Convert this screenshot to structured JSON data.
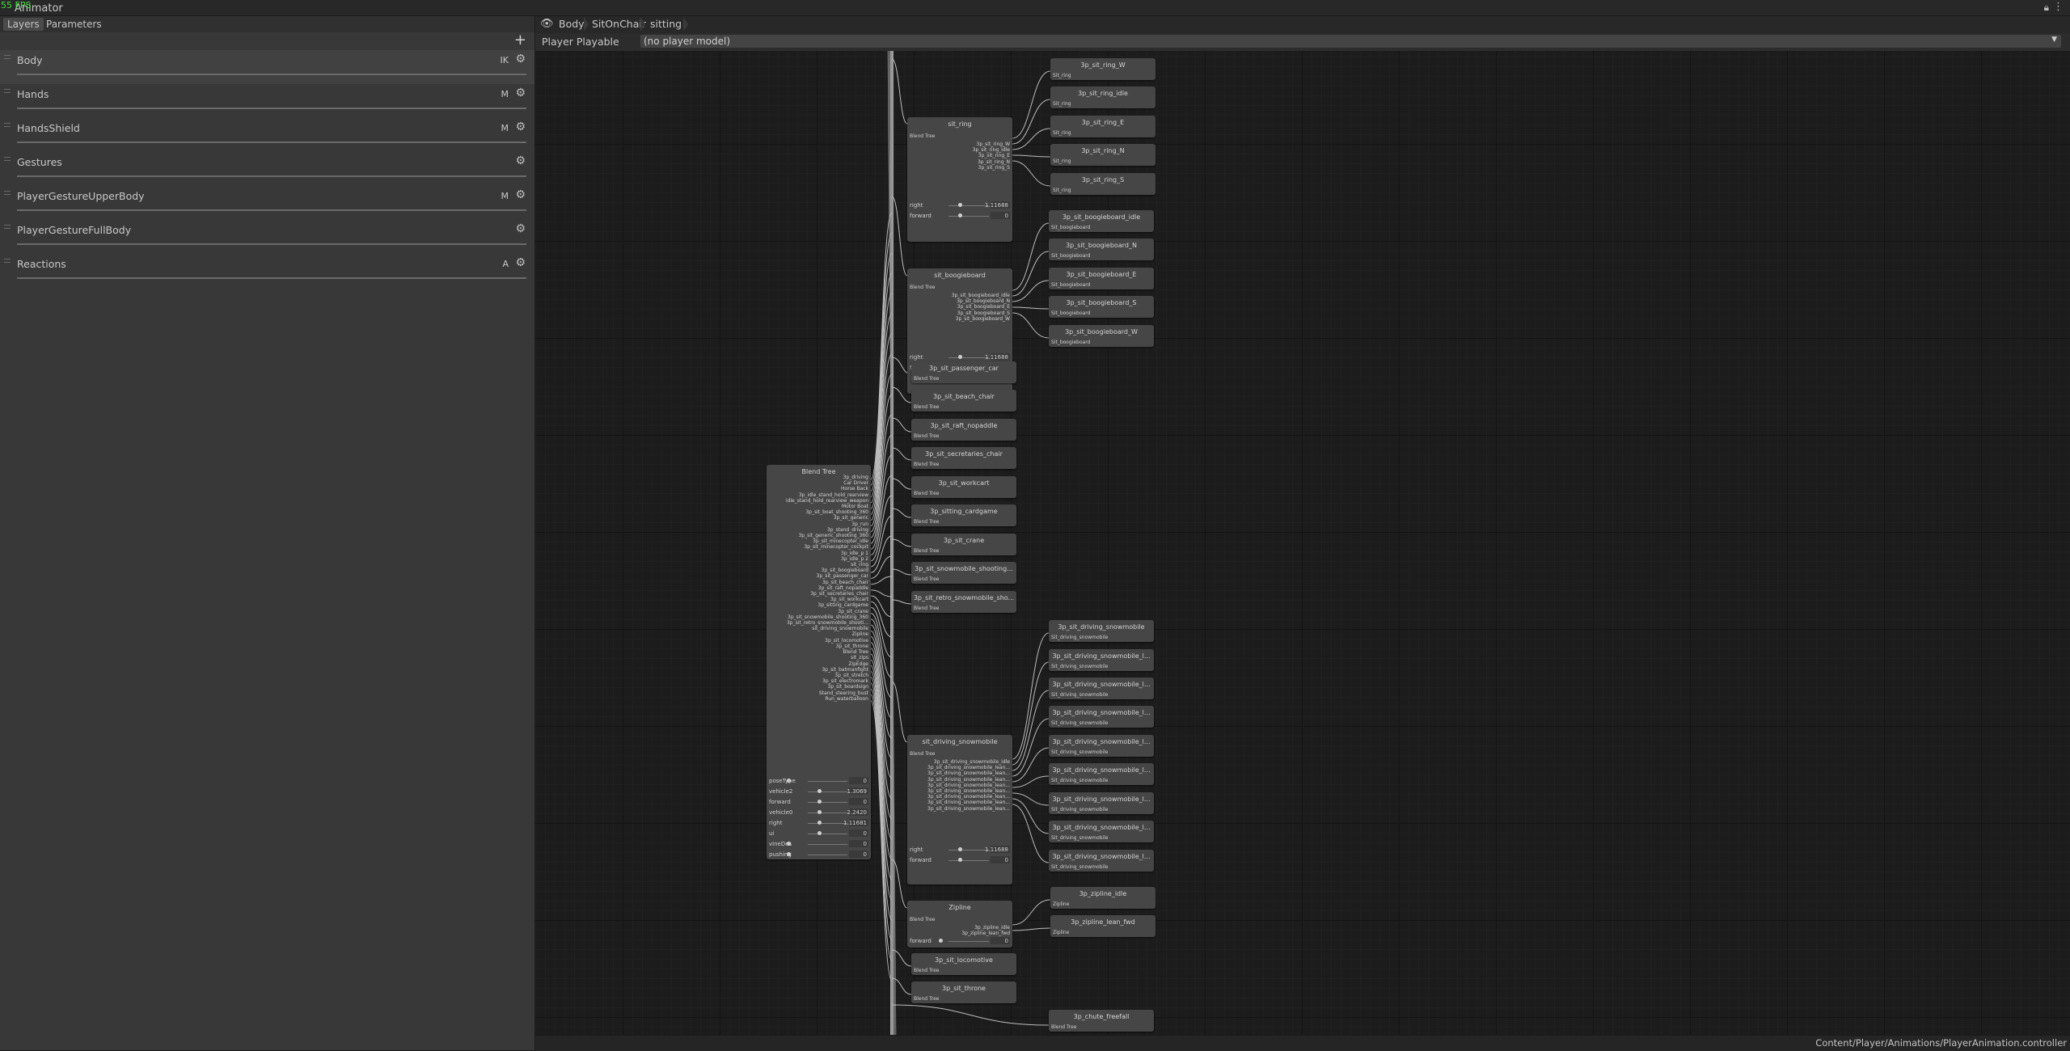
{
  "app": {
    "fps": "55 FPS",
    "title": "Animator"
  },
  "tabs": {
    "layers": "Layers",
    "parameters": "Parameters"
  },
  "add_layer": "+",
  "layers": [
    {
      "name": "Body",
      "badge": "IK"
    },
    {
      "name": "Hands",
      "badge": "M"
    },
    {
      "name": "HandsShield",
      "badge": "M"
    },
    {
      "name": "Gestures",
      "badge": ""
    },
    {
      "name": "PlayerGestureUpperBody",
      "badge": "M"
    },
    {
      "name": "PlayerGestureFullBody",
      "badge": ""
    },
    {
      "name": "Reactions",
      "badge": "A"
    }
  ],
  "breadcrumb": [
    "Body",
    "SitOnChair",
    "sitting"
  ],
  "player": {
    "label": "Player Playable",
    "value": "(no player model)"
  },
  "status_path": "Content/Player/Animations/PlayerAnimation.controller",
  "graph": {
    "main": {
      "title": "Blend Tree",
      "children": [
        "3p_driving",
        "Car Driver",
        "Horse Back",
        "3p_idle_stand_hold_rearview",
        "idle_stand_hold_rearview_weapon",
        "Motor Boat",
        "3p_sit_boat_shooting_360",
        "3p_sit_generic",
        "3p_run",
        "3p_stand_driving",
        "3p_sit_generic_shooting_360",
        "3p_sit_minecopter_idle",
        "3p_sit_minecopter_cockpit",
        "3p_idle_p 1",
        "3p_idle_p 2",
        "sit_ring",
        "3p_sit_boogieboard",
        "3p_sit_passenger_car",
        "3p_sit_beach_chair",
        "3p_sit_raft_nopaddle",
        "3p_sit_secretaries_chair",
        "3p_sit_workcart",
        "3p_sitting_cardgame",
        "3p_sit_crane",
        "3p_sit_snowmobile_shooting_360",
        "3p_sit_retro_snowmobile_shooti...",
        "sit_driving_snowmobile",
        "Zipline",
        "3p_sit_locomotive",
        "3p_sit_throne",
        "Blend Tree",
        "sit_zips",
        "ZipEdge",
        "3p_sit_batmanfight",
        "3p_sit_stretch",
        "3p_sit_electromark",
        "3p_sit_boardsign",
        "Stand_steering_bust",
        "Run_waterballoon"
      ],
      "params": [
        {
          "name": "poseType",
          "value": "0"
        },
        {
          "name": "vehicle2",
          "value": "1.3069"
        },
        {
          "name": "forward",
          "value": "0"
        },
        {
          "name": "vehicle0",
          "value": "2.2420"
        },
        {
          "name": "right",
          "value": "1.11681"
        },
        {
          "name": "ui",
          "value": "0"
        },
        {
          "name": "vineDes",
          "value": "0"
        },
        {
          "name": "pushing",
          "value": "0"
        }
      ]
    },
    "sit_ring": {
      "title": "sit_ring",
      "sub": "Blend Tree",
      "children": [
        "3p_sit_ring_W",
        "3p_sit_ring_idle",
        "3p_sit_ring_E",
        "3p_sit_ring_N",
        "3p_sit_ring_S"
      ],
      "params": [
        {
          "name": "right",
          "value": "1.11688"
        },
        {
          "name": "forward",
          "value": "0"
        }
      ]
    },
    "sit_boogieboard": {
      "title": "sit_boogieboard",
      "sub": "Blend Tree",
      "children": [
        "3p_sit_boogieboard_idle",
        "3p_sit_boogieboard_N",
        "3p_sit_boogieboard_E",
        "3p_sit_boogieboard_S",
        "3p_sit_boogieboard_W"
      ],
      "params": [
        {
          "name": "right",
          "value": "1.11688"
        },
        {
          "name": "forward",
          "value": "0"
        }
      ]
    },
    "sit_driving_snowmobile": {
      "title": "sit_driving_snowmobile",
      "sub": "Blend Tree",
      "children": [
        "3p_sit_driving_snowmobile_idle",
        "3p_sit_driving_snowmobile_lean...",
        "3p_sit_driving_snowmobile_lean...",
        "3p_sit_driving_snowmobile_lean...",
        "3p_sit_driving_snowmobile_lean...",
        "3p_sit_driving_snowmobile_lean...",
        "3p_sit_driving_snowmobile_lean...",
        "3p_sit_driving_snowmobile_lean...",
        "3p_sit_driving_snowmobile_lean..."
      ],
      "params": [
        {
          "name": "right",
          "value": "1.11688"
        },
        {
          "name": "forward",
          "value": "0"
        }
      ]
    },
    "zipline": {
      "title": "Zipline",
      "sub": "Blend Tree",
      "children": [
        "3p_zipline_idle",
        "3p_zipline_lean_fwd"
      ],
      "params": [
        {
          "name": "forward",
          "value": "0"
        }
      ]
    },
    "ring_clips": [
      {
        "title": "3p_sit_ring_W",
        "sub": "Sit_ring"
      },
      {
        "title": "3p_sit_ring_idle",
        "sub": "Sit_ring"
      },
      {
        "title": "3p_sit_ring_E",
        "sub": "Sit_ring"
      },
      {
        "title": "3p_sit_ring_N",
        "sub": "Sit_ring"
      },
      {
        "title": "3p_sit_ring_S",
        "sub": "Sit_ring"
      }
    ],
    "boogie_clips": [
      {
        "title": "3p_sit_boogieboard_idle",
        "sub": "Sit_boogieboard"
      },
      {
        "title": "3p_sit_boogieboard_N",
        "sub": "Sit_boogieboard"
      },
      {
        "title": "3p_sit_boogieboard_E",
        "sub": "Sit_boogieboard"
      },
      {
        "title": "3p_sit_boogieboard_S",
        "sub": "Sit_boogieboard"
      },
      {
        "title": "3p_sit_boogieboard_W",
        "sub": "Sit_boogieboard"
      }
    ],
    "subtrees": [
      {
        "title": "3p_sit_passenger_car",
        "sub": "Blend Tree"
      },
      {
        "title": "3p_sit_beach_chair",
        "sub": "Blend Tree"
      },
      {
        "title": "3p_sit_raft_nopaddle",
        "sub": "Blend Tree"
      },
      {
        "title": "3p_sit_secretaries_chair",
        "sub": "Blend Tree"
      },
      {
        "title": "3p_sit_workcart",
        "sub": "Blend Tree"
      },
      {
        "title": "3p_sitting_cardgame",
        "sub": "Blend Tree"
      },
      {
        "title": "3p_sit_crane",
        "sub": "Blend Tree"
      },
      {
        "title": "3p_sit_snowmobile_shooting...",
        "sub": "Blend Tree"
      },
      {
        "title": "3p_sit_retro_snowmobile_sho...",
        "sub": "Blend Tree"
      }
    ],
    "snow_clips": [
      {
        "title": "3p_sit_driving_snowmobile",
        "sub": "Sit_driving_snowmobile"
      },
      {
        "title": "3p_sit_driving_snowmobile_l...",
        "sub": "Sit_driving_snowmobile"
      },
      {
        "title": "3p_sit_driving_snowmobile_l...",
        "sub": "Sit_driving_snowmobile"
      },
      {
        "title": "3p_sit_driving_snowmobile_l...",
        "sub": "Sit_driving_snowmobile"
      },
      {
        "title": "3p_sit_driving_snowmobile_l...",
        "sub": "Sit_driving_snowmobile"
      },
      {
        "title": "3p_sit_driving_snowmobile_l...",
        "sub": "Sit_driving_snowmobile"
      },
      {
        "title": "3p_sit_driving_snowmobile_l...",
        "sub": "Sit_driving_snowmobile"
      },
      {
        "title": "3p_sit_driving_snowmobile_l...",
        "sub": "Sit_driving_snowmobile"
      },
      {
        "title": "3p_sit_driving_snowmobile_l...",
        "sub": "Sit_driving_snowmobile"
      }
    ],
    "zip_clips": [
      {
        "title": "3p_zipline_idle",
        "sub": "Zipline"
      },
      {
        "title": "3p_zipline_lean_fwd",
        "sub": "Zipline"
      }
    ],
    "bottom_subtrees": [
      {
        "title": "3p_sit_locomotive",
        "sub": "Blend Tree"
      },
      {
        "title": "3p_sit_throne",
        "sub": "Blend Tree"
      }
    ],
    "chute": {
      "title": "3p_chute_freefall",
      "sub": "Blend Tree"
    }
  }
}
